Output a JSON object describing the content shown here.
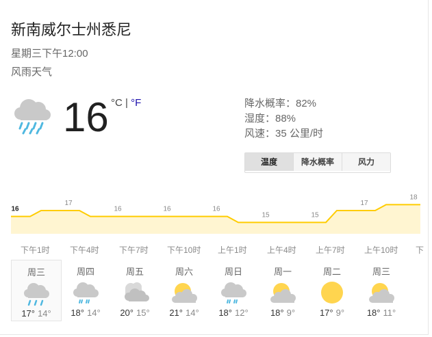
{
  "location": "新南威尔士州悉尼",
  "time": "星期三下午12:00",
  "condition": "风雨天气",
  "current": {
    "temp": "16",
    "unit_c": "°C",
    "sep": "|",
    "unit_f": "°F",
    "icon": "rain-cloud-icon"
  },
  "details": {
    "precip": "降水概率：82%",
    "humidity": "湿度：88%",
    "wind": "风速：35 公里/时"
  },
  "tabs": [
    "温度",
    "降水概率",
    "风力"
  ],
  "colors": {
    "chart_line": "#ffcc00",
    "chart_fill": "#fff5d1",
    "sun": "#ffd54f",
    "rain": "#4fb8e0",
    "cloud": "#c9c9c9"
  },
  "chart_data": {
    "type": "area",
    "x": [
      "下午1时",
      "下午4时",
      "下午7时",
      "下午10时",
      "上午1时",
      "上午4时",
      "上午7时",
      "上午10时",
      "下"
    ],
    "values": [
      16,
      17,
      16,
      16,
      16,
      15,
      15,
      17,
      18
    ],
    "labels": [
      "16",
      "17",
      "16",
      "16",
      "16",
      "15",
      "15",
      "17",
      "18"
    ],
    "title": "",
    "xlabel": "",
    "ylabel": ""
  },
  "days": [
    {
      "name": "周三",
      "icon": "rain-icon",
      "hi": "17°",
      "lo": "14°"
    },
    {
      "name": "周四",
      "icon": "light-rain-icon",
      "hi": "18°",
      "lo": "14°"
    },
    {
      "name": "周五",
      "icon": "cloudy-icon",
      "hi": "20°",
      "lo": "15°"
    },
    {
      "name": "周六",
      "icon": "partly-cloudy-icon",
      "hi": "21°",
      "lo": "14°"
    },
    {
      "name": "周日",
      "icon": "light-rain-icon",
      "hi": "18°",
      "lo": "12°"
    },
    {
      "name": "周一",
      "icon": "partly-cloudy-icon",
      "hi": "18°",
      "lo": "9°"
    },
    {
      "name": "周二",
      "icon": "sunny-icon",
      "hi": "17°",
      "lo": "9°"
    },
    {
      "name": "周三",
      "icon": "partly-cloudy-icon",
      "hi": "18°",
      "lo": "11°"
    }
  ]
}
